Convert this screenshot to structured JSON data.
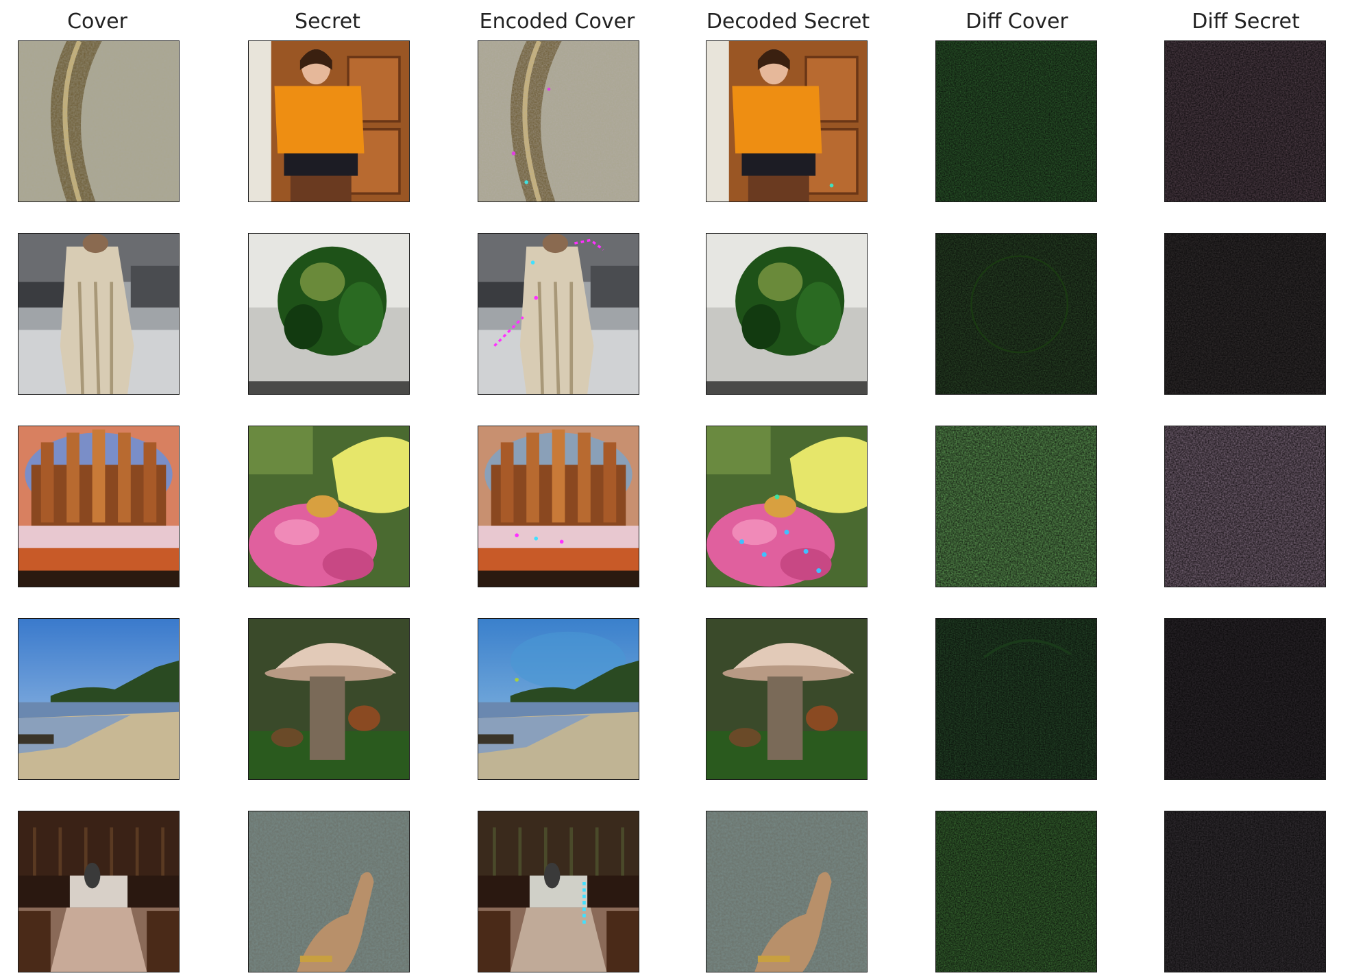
{
  "columns": [
    "Cover",
    "Secret",
    "Encoded Cover",
    "Decoded Secret",
    "Diff Cover",
    "Diff Secret"
  ],
  "rows": [
    {
      "cover": "stone-ground-with-curved-pebble-path",
      "secret": "woman-in-orange-top-by-wooden-door",
      "encoded_cover": "stone-ground-with-curved-pebble-path-noisy",
      "decoded_secret": "woman-in-orange-top-by-wooden-door",
      "diff_cover": "dark-noise-green",
      "diff_secret": "dark-noise-rgb"
    },
    {
      "cover": "person-in-fur-coat-on-street",
      "secret": "green-bell-pepper-on-table",
      "encoded_cover": "person-in-fur-coat-on-street-noisy",
      "decoded_secret": "green-bell-pepper-on-table",
      "diff_cover": "dark-noise-green-faint",
      "diff_secret": "dark-noise-faint"
    },
    {
      "cover": "ornate-towers-with-flower-beds",
      "secret": "yellow-butterfly-on-pink-flower",
      "encoded_cover": "ornate-towers-with-flower-beds-noisy",
      "decoded_secret": "yellow-butterfly-on-pink-flower-noisy",
      "diff_cover": "dark-noise-green-strong",
      "diff_secret": "dark-noise-rgb-strong"
    },
    {
      "cover": "beach-with-blue-sky-and-trees",
      "secret": "pale-mushroom-in-forest",
      "encoded_cover": "beach-with-blue-sky-and-trees-noisy",
      "decoded_secret": "pale-mushroom-in-forest",
      "diff_cover": "dark-noise-green-faint",
      "diff_secret": "dark-noise-faint"
    },
    {
      "cover": "church-interior-with-altar",
      "secret": "hand-holding-object-over-patterned-fabric",
      "encoded_cover": "church-interior-with-altar-noisy",
      "decoded_secret": "hand-holding-object-over-patterned-fabric",
      "diff_cover": "dark-noise-green",
      "diff_secret": "dark-noise-faint"
    }
  ],
  "colors": {
    "stone": "#a8a48e",
    "orange": "#e88a10",
    "wood": "#a05a28",
    "pepper": "#1f5a18",
    "sky": "#3f82cc",
    "sand": "#c9b99a",
    "pink": "#e0609e",
    "yellow": "#e8e060",
    "church": "#3a2014",
    "diff_green": "#1a4a14"
  }
}
